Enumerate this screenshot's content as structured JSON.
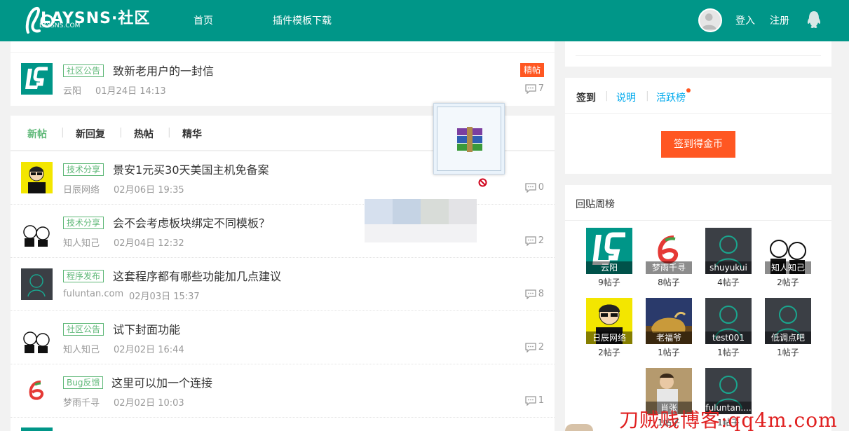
{
  "header": {
    "logo_text": "LAYSNS·社区",
    "logo_sub": "LAYSNS.COM",
    "nav": [
      "首页",
      "插件模板下载"
    ],
    "login": "登入",
    "register": "注册"
  },
  "top_post": {
    "tag": "社区公告",
    "title": "致新老用户的一封信",
    "author": "云阳",
    "time": "01月24日 14:13",
    "comments": "7",
    "badge": "精帖"
  },
  "tabs": [
    "新帖",
    "新回复",
    "热帖",
    "精华"
  ],
  "posts": [
    {
      "tag": "技术分享",
      "title": "景安1元买30天美国主机免备案",
      "author": "日辰网络",
      "time": "02月06日 19:35",
      "comments": "0"
    },
    {
      "tag": "技术分享",
      "title": "会不会考虑板块绑定不同模板？",
      "author": "知人知己",
      "time": "02月04日 12:32",
      "comments": "2"
    },
    {
      "tag": "程序发布",
      "title": "这套程序都有哪些功能加几点建议",
      "author": "fuluntan.com",
      "time": "02月03日 15:37",
      "comments": "8"
    },
    {
      "tag": "社区公告",
      "title": "试下封面功能",
      "author": "知人知己",
      "time": "02月02日 16:44",
      "comments": "2"
    },
    {
      "tag": "Bug反馈",
      "title": "这里可以加一个连接",
      "author": "梦雨千寻",
      "time": "02月02日 10:03",
      "comments": "1"
    }
  ],
  "signin": {
    "tabs": [
      "签到",
      "说明",
      "活跃榜"
    ],
    "button": "签到得金币"
  },
  "ranking": {
    "title": "回贴周榜",
    "items": [
      {
        "name": "云阳",
        "count": "9帖子"
      },
      {
        "name": "梦雨千寻",
        "count": "8帖子"
      },
      {
        "name": "shuyukui",
        "count": "4帖子"
      },
      {
        "name": "知人知己",
        "count": "2帖子"
      },
      {
        "name": "日辰网络",
        "count": "2帖子"
      },
      {
        "name": "老福爷",
        "count": "1帖子"
      },
      {
        "name": "test001",
        "count": "1帖子"
      },
      {
        "name": "低调点吧",
        "count": "1帖子"
      },
      {
        "name": "肖张",
        "count": "1帖子"
      },
      {
        "name": "fuluntan....",
        "count": "1帖子"
      }
    ]
  },
  "watermark": "刀贼贱博客:qq4m.com",
  "colors": {
    "primary": "#009688",
    "accent": "#FF5722",
    "tag": "#5FB878",
    "link": "#01AAED"
  }
}
